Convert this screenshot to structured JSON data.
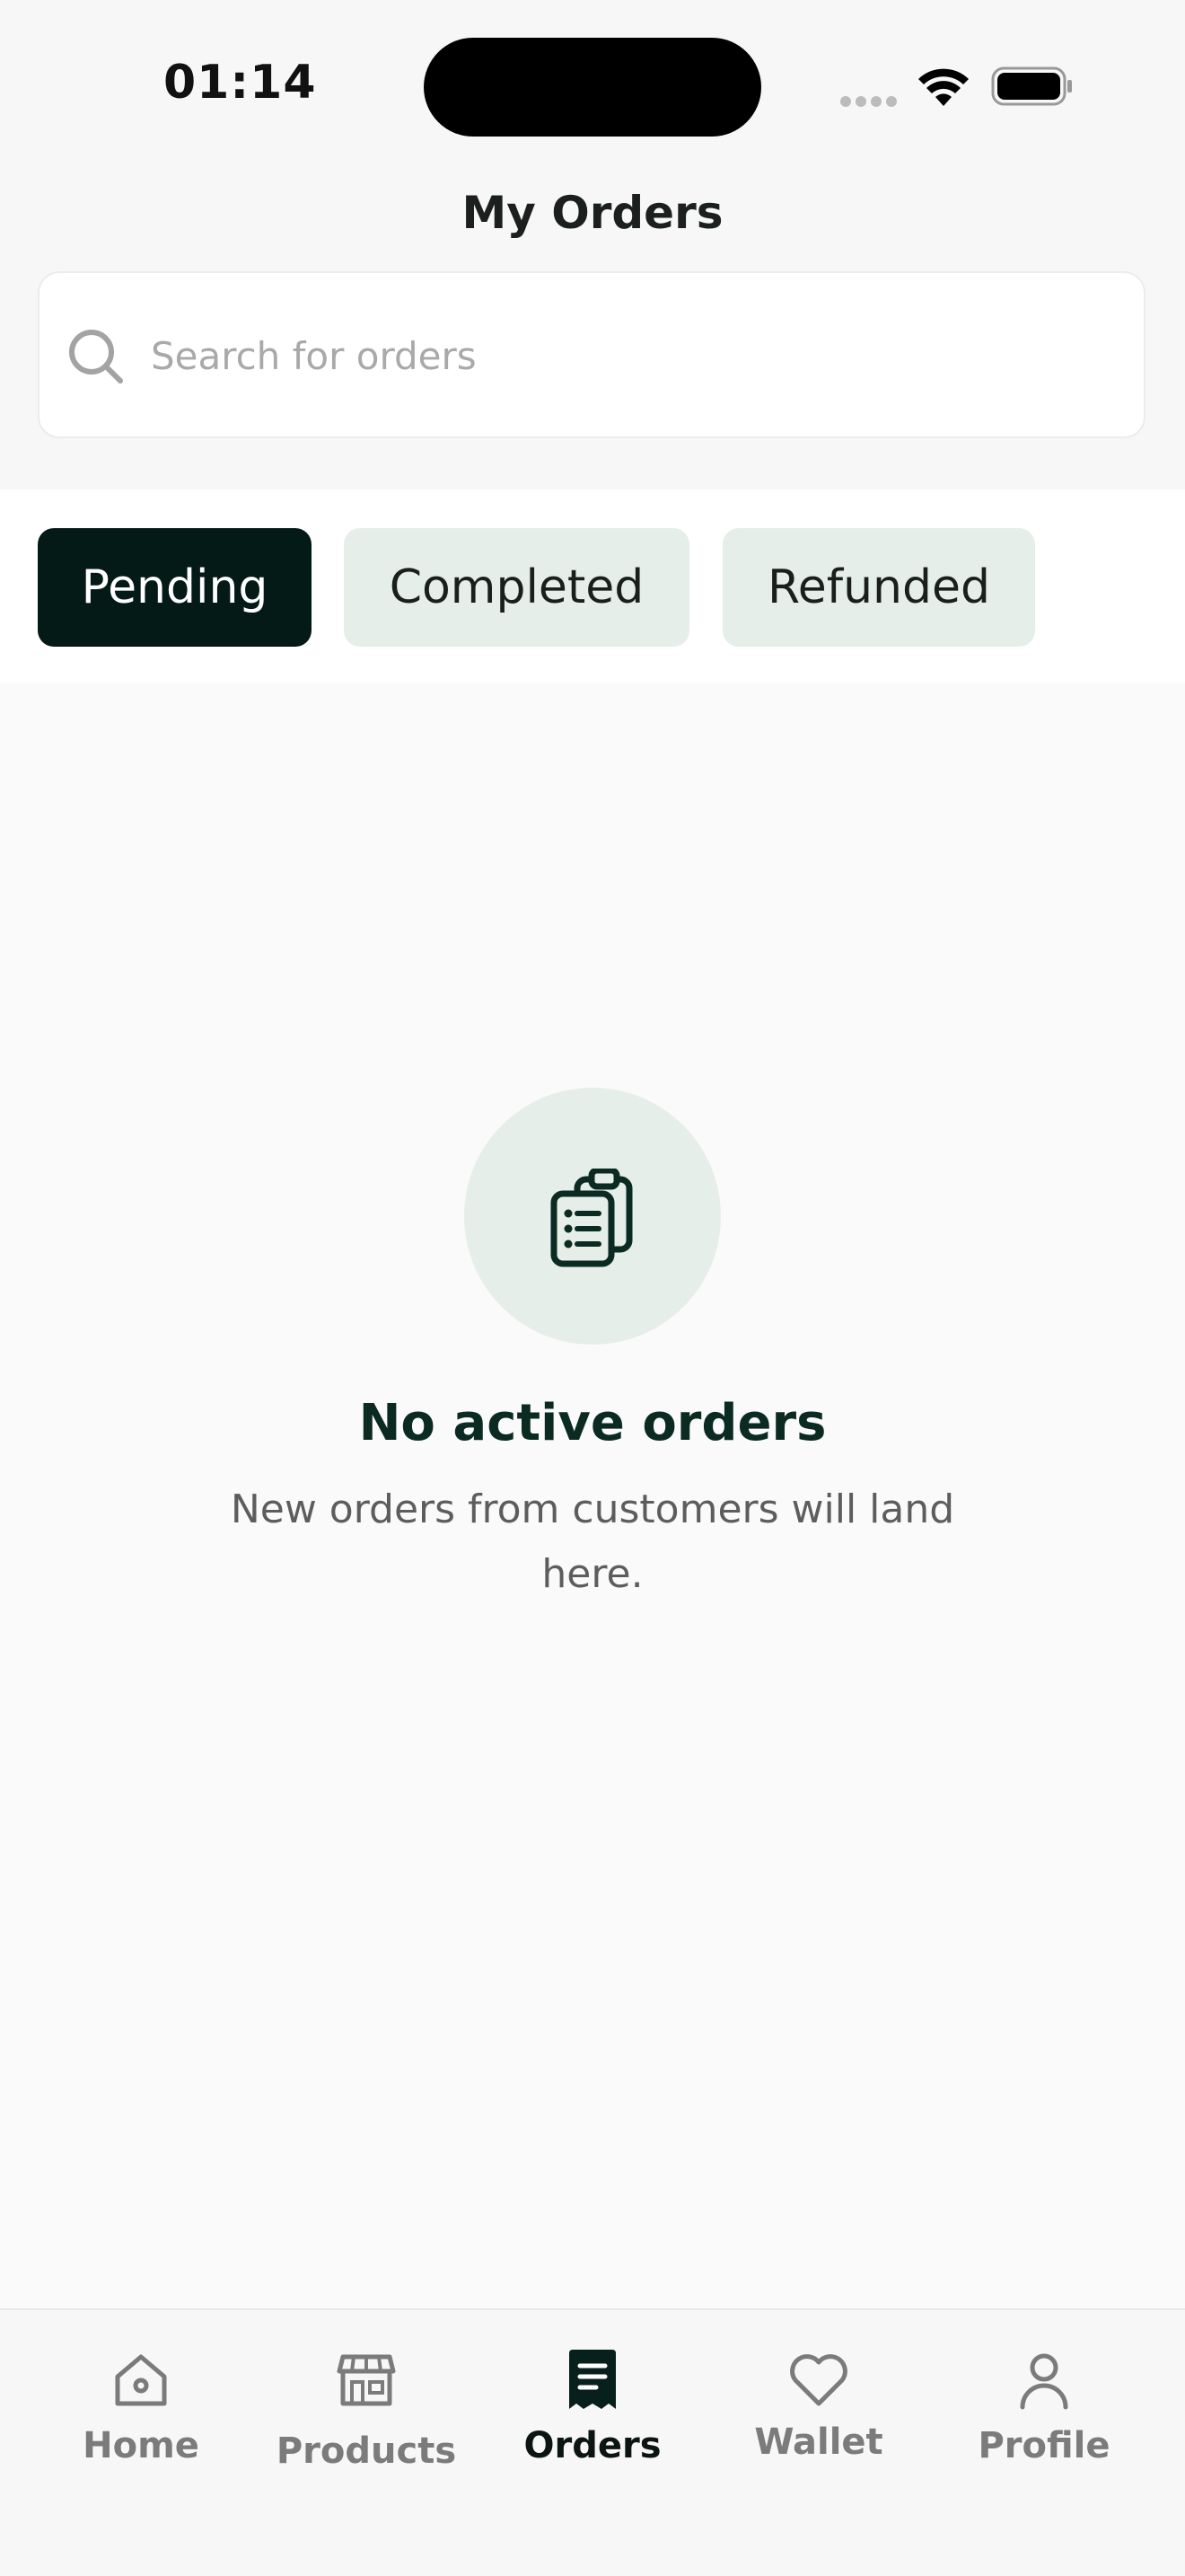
{
  "status_bar": {
    "time": "01:14"
  },
  "header": {
    "title": "My Orders"
  },
  "search": {
    "placeholder": "Search for orders"
  },
  "tabs": [
    {
      "label": "Pending",
      "active": true
    },
    {
      "label": "Completed",
      "active": false
    },
    {
      "label": "Refunded",
      "active": false
    }
  ],
  "empty_state": {
    "icon": "clipboard-list-icon",
    "title": "No active orders",
    "description": "New orders from customers will land here."
  },
  "bottom_nav": {
    "items": [
      {
        "label": "Home",
        "icon": "home-icon",
        "active": false
      },
      {
        "label": "Products",
        "icon": "store-icon",
        "active": false
      },
      {
        "label": "Orders",
        "icon": "receipt-icon",
        "active": true
      },
      {
        "label": "Wallet",
        "icon": "heart-icon",
        "active": false
      },
      {
        "label": "Profile",
        "icon": "user-icon",
        "active": false
      }
    ]
  },
  "colors": {
    "primary_dark": "#041a16",
    "chip_inactive": "#e6eee9",
    "title_green": "#0a2a22",
    "muted_gray": "#7b7b7b",
    "background": "#fafafa"
  }
}
